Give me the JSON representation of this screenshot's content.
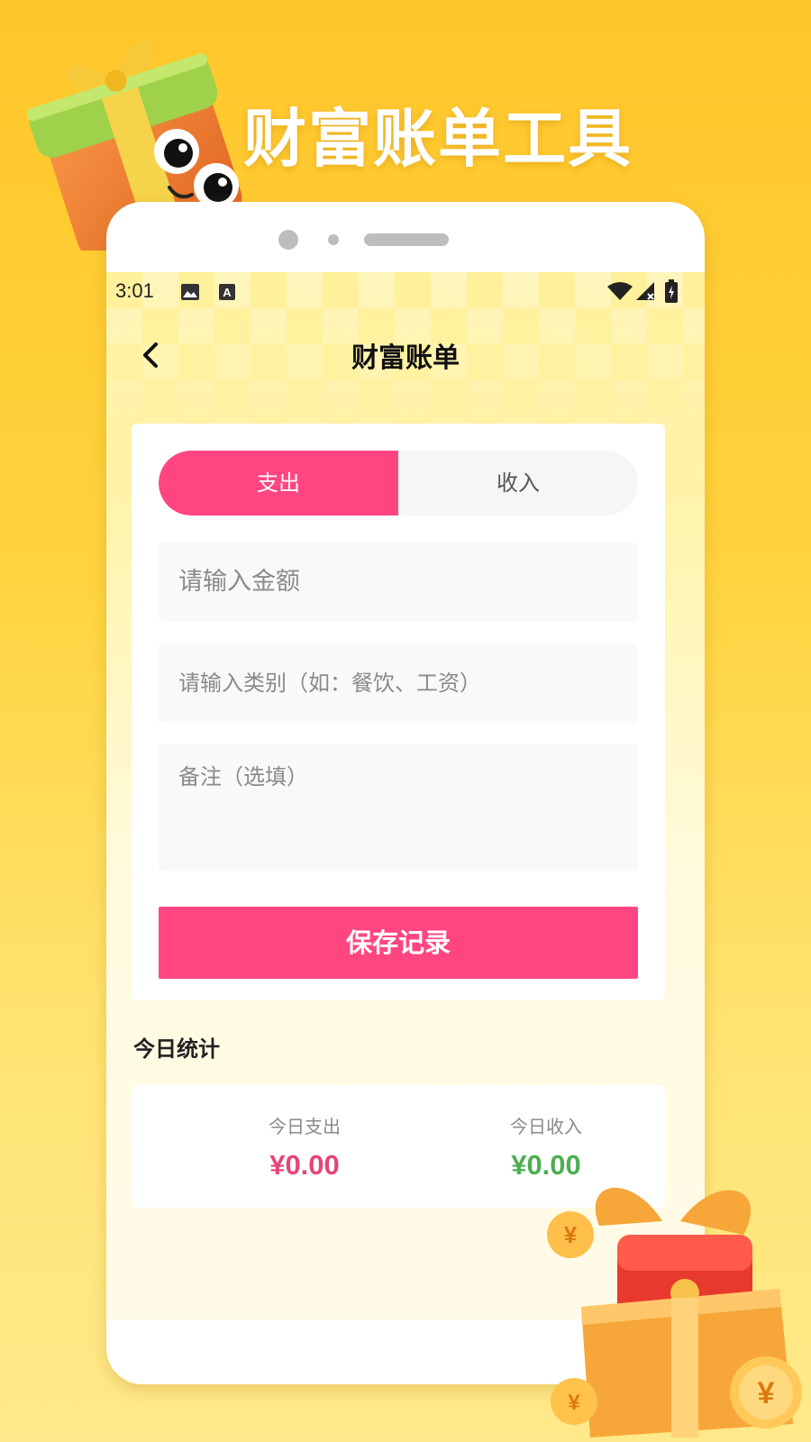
{
  "headline": "财富账单工具",
  "status_bar": {
    "time": "3:01",
    "icons": [
      "image-icon",
      "font-a-icon",
      "wifi-icon",
      "signal-icon",
      "battery-icon"
    ]
  },
  "app_bar": {
    "back_icon": "chevron-left-icon",
    "title": "财富账单"
  },
  "form": {
    "toggle": {
      "expense_label": "支出",
      "income_label": "收入",
      "selected": "expense"
    },
    "amount_placeholder": "请输入金额",
    "category_placeholder": "请输入类别（如：餐饮、工资）",
    "note_placeholder": "备注（选填）",
    "save_label": "保存记录"
  },
  "today": {
    "section_title": "今日统计",
    "expense_label": "今日支出",
    "expense_value": "¥0.00",
    "income_label": "今日收入",
    "income_value": "¥0.00"
  },
  "colors": {
    "accent_pink": "#ff4680",
    "income_green": "#4caf50",
    "expense_pink": "#e8437c",
    "background_yellow": "#ffd43f"
  },
  "decorations": [
    "gift-box-mascot-icon",
    "red-packet-gift-icon"
  ]
}
